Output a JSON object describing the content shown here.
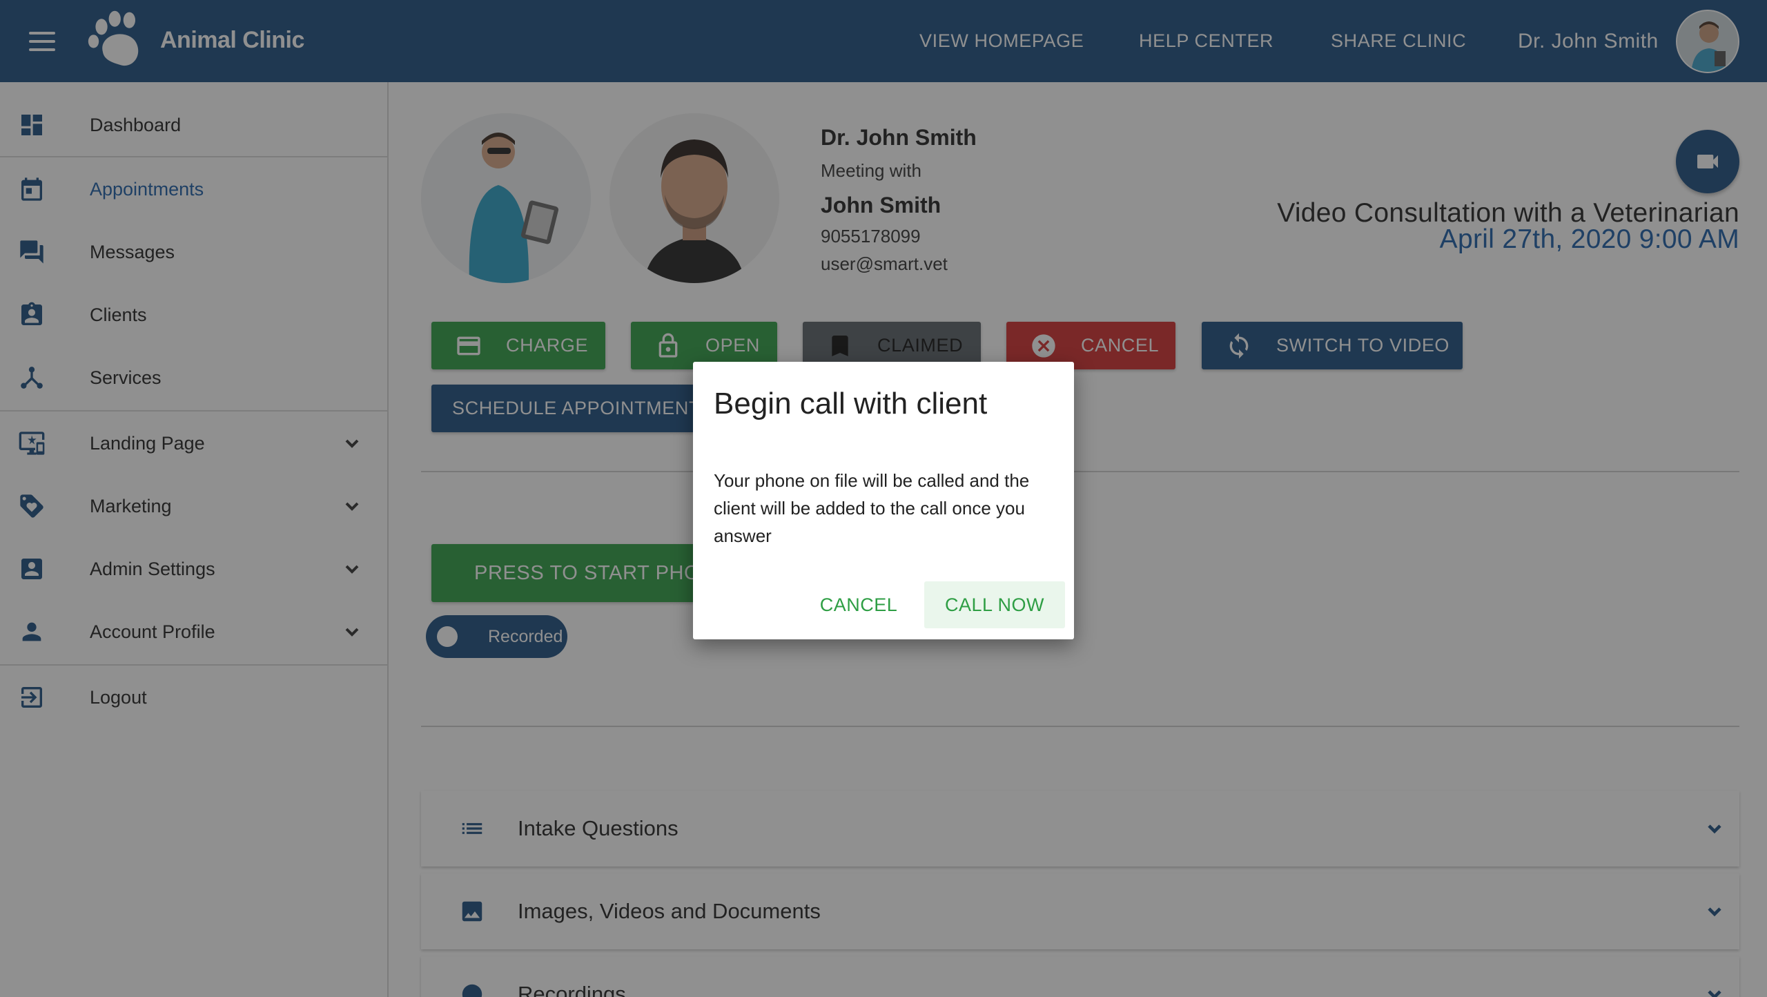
{
  "header": {
    "brand": "Animal Clinic",
    "nav": [
      "VIEW HOMEPAGE",
      "HELP CENTER",
      "SHARE CLINIC"
    ],
    "user_name": "Dr. John Smith"
  },
  "sidebar": {
    "items": [
      {
        "label": "Dashboard",
        "icon": "dashboard-icon"
      },
      {
        "label": "Appointments",
        "icon": "calendar-icon",
        "active": true
      },
      {
        "label": "Messages",
        "icon": "chat-icon"
      },
      {
        "label": "Clients",
        "icon": "contact-badge-icon"
      },
      {
        "label": "Services",
        "icon": "hub-icon"
      },
      {
        "label": "Landing Page",
        "icon": "monitor-star-icon",
        "expandable": true
      },
      {
        "label": "Marketing",
        "icon": "tag-icon",
        "expandable": true
      },
      {
        "label": "Admin Settings",
        "icon": "account-box-icon",
        "expandable": true
      },
      {
        "label": "Account Profile",
        "icon": "person-icon",
        "expandable": true
      },
      {
        "label": "Logout",
        "icon": "logout-icon"
      }
    ]
  },
  "appointment": {
    "doctor_name": "Dr. John Smith",
    "meeting_with": "Meeting with",
    "client_name": "John Smith",
    "client_phone": "9055178099",
    "client_email": "user@smart.vet",
    "title": "Video Consultation with a Veterinarian",
    "date": "April 27th, 2020 9:00 AM"
  },
  "actions": {
    "charge": "CHARGE",
    "open": "OPEN",
    "claimed": "CLAIMED",
    "cancel": "CANCEL",
    "switch": "SWITCH TO VIDEO",
    "schedule": "SCHEDULE APPOINTMENT",
    "start_phone": "PRESS TO START PHONE CALL",
    "recorded": "Recorded"
  },
  "panels": [
    {
      "label": "Intake Questions",
      "icon": "list-icon"
    },
    {
      "label": "Images, Videos and Documents",
      "icon": "image-icon"
    },
    {
      "label": "Recordings",
      "icon": "record-icon"
    }
  ],
  "dialog": {
    "title": "Begin call with client",
    "body": "Your phone on file will be called and the client will be added to the call once you answer",
    "cancel": "CANCEL",
    "confirm": "CALL NOW"
  },
  "colors": {
    "primary": "#1c4e80",
    "success": "#2e9e44",
    "danger": "#d32f2f",
    "muted": "#5a6268"
  }
}
